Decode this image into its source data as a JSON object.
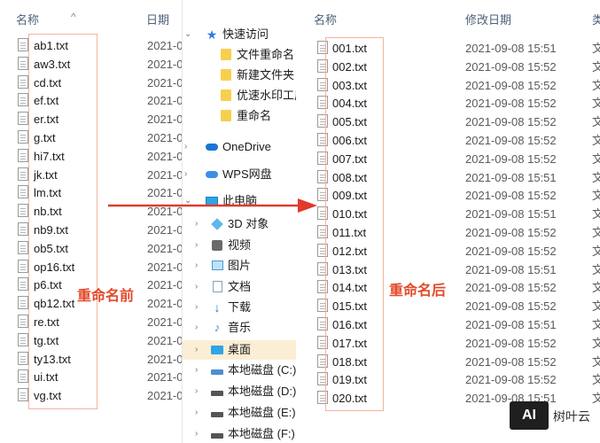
{
  "left_pane": {
    "col_name": "名称",
    "col_date": "日期",
    "sort_caret": "^",
    "files": [
      {
        "name": "ab1.txt",
        "date": "2021-0"
      },
      {
        "name": "aw3.txt",
        "date": "2021-0"
      },
      {
        "name": "cd.txt",
        "date": "2021-0"
      },
      {
        "name": "ef.txt",
        "date": "2021-0"
      },
      {
        "name": "er.txt",
        "date": "2021-0"
      },
      {
        "name": "g.txt",
        "date": "2021-0"
      },
      {
        "name": "hi7.txt",
        "date": "2021-0"
      },
      {
        "name": "jk.txt",
        "date": "2021-0"
      },
      {
        "name": "lm.txt",
        "date": "2021-0"
      },
      {
        "name": "nb.txt",
        "date": "2021-0"
      },
      {
        "name": "nb9.txt",
        "date": "2021-0"
      },
      {
        "name": "ob5.txt",
        "date": "2021-0"
      },
      {
        "name": "op16.txt",
        "date": "2021-0"
      },
      {
        "name": "p6.txt",
        "date": "2021-0"
      },
      {
        "name": "qb12.txt",
        "date": "2021-0"
      },
      {
        "name": "re.txt",
        "date": "2021-0"
      },
      {
        "name": "tg.txt",
        "date": "2021-0"
      },
      {
        "name": "ty13.txt",
        "date": "2021-0"
      },
      {
        "name": "ui.txt",
        "date": "2021-0"
      },
      {
        "name": "vg.txt",
        "date": "2021-0"
      }
    ],
    "caption": "重命名前"
  },
  "nav_pane": {
    "items": [
      {
        "label": "快速访问",
        "icon": "star-icon",
        "chevron": "⌄"
      },
      {
        "label": "文件重命名",
        "icon": "folder-icon"
      },
      {
        "label": "新建文件夹",
        "icon": "folder-icon"
      },
      {
        "label": "优速水印工厂",
        "icon": "folder-icon"
      },
      {
        "label": "重命名",
        "icon": "folder-icon"
      },
      {
        "label": "OneDrive",
        "icon": "onedrive-cloud-icon",
        "chevron": "›"
      },
      {
        "label": "WPS网盘",
        "icon": "wps-cloud-icon",
        "chevron": "›"
      },
      {
        "label": "此电脑",
        "icon": "this-pc-icon",
        "chevron": "⌄"
      },
      {
        "label": "3D 对象",
        "icon": "3d-objects-icon",
        "chevron": "›"
      },
      {
        "label": "视频",
        "icon": "video-icon",
        "chevron": "›"
      },
      {
        "label": "图片",
        "icon": "pictures-icon",
        "chevron": "›"
      },
      {
        "label": "文档",
        "icon": "documents-icon",
        "chevron": "›"
      },
      {
        "label": "下载",
        "icon": "download-icon",
        "chevron": "›"
      },
      {
        "label": "音乐",
        "icon": "music-icon",
        "chevron": "›"
      },
      {
        "label": "桌面",
        "icon": "desktop-icon",
        "chevron": "›"
      },
      {
        "label": "本地磁盘 (C:)",
        "icon": "drive-c-icon",
        "chevron": "›"
      },
      {
        "label": "本地磁盘 (D:)",
        "icon": "drive-icon",
        "chevron": "›"
      },
      {
        "label": "本地磁盘 (E:)",
        "icon": "drive-icon",
        "chevron": "›"
      },
      {
        "label": "本地磁盘 (F:)",
        "icon": "drive-icon",
        "chevron": "›"
      }
    ],
    "selected_label": "桌面"
  },
  "right_pane": {
    "col_name": "名称",
    "col_date": "修改日期",
    "col_type": "类",
    "files": [
      {
        "name": "001.txt",
        "date": "2021-09-08 15:51",
        "type": "文"
      },
      {
        "name": "002.txt",
        "date": "2021-09-08 15:52",
        "type": "文"
      },
      {
        "name": "003.txt",
        "date": "2021-09-08 15:52",
        "type": "文"
      },
      {
        "name": "004.txt",
        "date": "2021-09-08 15:52",
        "type": "文"
      },
      {
        "name": "005.txt",
        "date": "2021-09-08 15:52",
        "type": "文"
      },
      {
        "name": "006.txt",
        "date": "2021-09-08 15:52",
        "type": "文"
      },
      {
        "name": "007.txt",
        "date": "2021-09-08 15:52",
        "type": "文"
      },
      {
        "name": "008.txt",
        "date": "2021-09-08 15:51",
        "type": "文"
      },
      {
        "name": "009.txt",
        "date": "2021-09-08 15:52",
        "type": "文"
      },
      {
        "name": "010.txt",
        "date": "2021-09-08 15:51",
        "type": "文"
      },
      {
        "name": "011.txt",
        "date": "2021-09-08 15:52",
        "type": "文"
      },
      {
        "name": "012.txt",
        "date": "2021-09-08 15:52",
        "type": "文"
      },
      {
        "name": "013.txt",
        "date": "2021-09-08 15:51",
        "type": "文"
      },
      {
        "name": "014.txt",
        "date": "2021-09-08 15:52",
        "type": "文"
      },
      {
        "name": "015.txt",
        "date": "2021-09-08 15:52",
        "type": "文"
      },
      {
        "name": "016.txt",
        "date": "2021-09-08 15:51",
        "type": "文"
      },
      {
        "name": "017.txt",
        "date": "2021-09-08 15:52",
        "type": "文"
      },
      {
        "name": "018.txt",
        "date": "2021-09-08 15:52",
        "type": "文"
      },
      {
        "name": "019.txt",
        "date": "2021-09-08 15:52",
        "type": "文"
      },
      {
        "name": "020.txt",
        "date": "2021-09-08 15:51",
        "type": "文"
      }
    ],
    "caption": "重命名后"
  },
  "watermark": {
    "logo_text": "AI",
    "brand_text": "树叶云"
  },
  "colors": {
    "caption": "#e24a2a",
    "arrow": "#e03a2a",
    "highlight_border": "#f2b59e",
    "selected_row": "#fcf1d7",
    "header_text": "#4c607a"
  }
}
